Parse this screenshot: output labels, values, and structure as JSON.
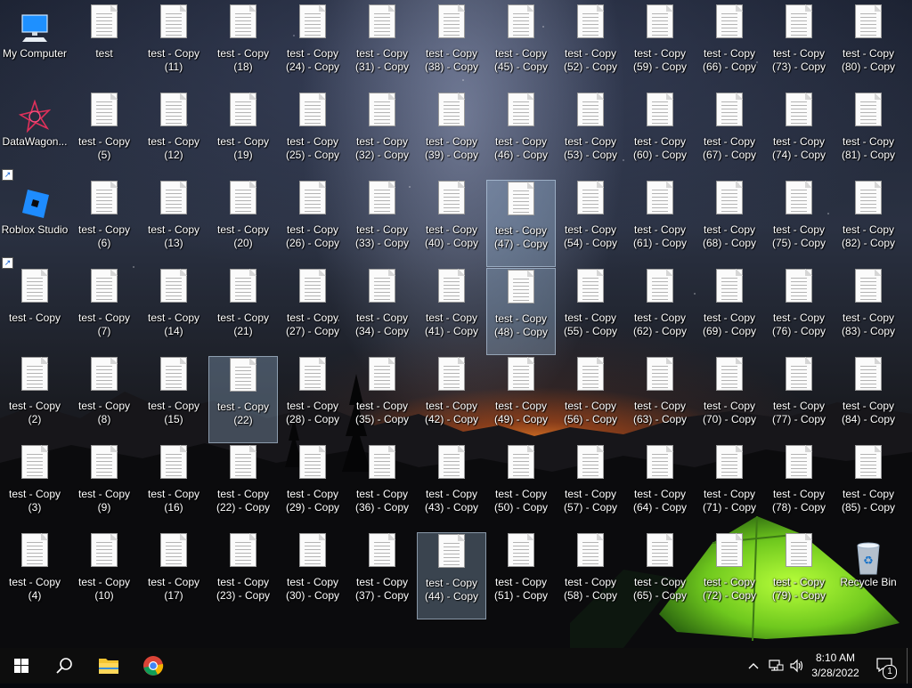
{
  "desktop": {
    "icons": [
      {
        "label": "My Computer",
        "type": "computer",
        "col": 0,
        "row": 0
      },
      {
        "label": "DataWagon...",
        "type": "datawagon",
        "col": 0,
        "row": 1
      },
      {
        "label": "Roblox Studio",
        "type": "roblox",
        "col": 0,
        "row": 2
      },
      {
        "label": "test - Copy",
        "type": "doc",
        "col": 0,
        "row": 3
      },
      {
        "label": "test - Copy\n(2)",
        "type": "doc",
        "col": 0,
        "row": 4
      },
      {
        "label": "test - Copy\n(3)",
        "type": "doc",
        "col": 0,
        "row": 5
      },
      {
        "label": "test - Copy\n(4)",
        "type": "doc",
        "col": 0,
        "row": 6
      },
      {
        "label": "test",
        "type": "doc",
        "col": 1,
        "row": 0
      },
      {
        "label": "test - Copy\n(5)",
        "type": "doc",
        "col": 1,
        "row": 1
      },
      {
        "label": "test - Copy\n(6)",
        "type": "doc",
        "col": 1,
        "row": 2
      },
      {
        "label": "test - Copy\n(7)",
        "type": "doc",
        "col": 1,
        "row": 3
      },
      {
        "label": "test - Copy\n(8)",
        "type": "doc",
        "col": 1,
        "row": 4
      },
      {
        "label": "test - Copy\n(9)",
        "type": "doc",
        "col": 1,
        "row": 5
      },
      {
        "label": "test - Copy\n(10)",
        "type": "doc",
        "col": 1,
        "row": 6
      },
      {
        "label": "test - Copy\n(11)",
        "type": "doc",
        "col": 2,
        "row": 0
      },
      {
        "label": "test - Copy\n(12)",
        "type": "doc",
        "col": 2,
        "row": 1
      },
      {
        "label": "test - Copy\n(13)",
        "type": "doc",
        "col": 2,
        "row": 2
      },
      {
        "label": "test - Copy\n(14)",
        "type": "doc",
        "col": 2,
        "row": 3
      },
      {
        "label": "test - Copy\n(15)",
        "type": "doc",
        "col": 2,
        "row": 4
      },
      {
        "label": "test - Copy\n(16)",
        "type": "doc",
        "col": 2,
        "row": 5
      },
      {
        "label": "test - Copy\n(17)",
        "type": "doc",
        "col": 2,
        "row": 6
      },
      {
        "label": "test - Copy\n(18)",
        "type": "doc",
        "col": 3,
        "row": 0
      },
      {
        "label": "test - Copy\n(19)",
        "type": "doc",
        "col": 3,
        "row": 1
      },
      {
        "label": "test - Copy\n(20)",
        "type": "doc",
        "col": 3,
        "row": 2
      },
      {
        "label": "test - Copy\n(21)",
        "type": "doc",
        "col": 3,
        "row": 3
      },
      {
        "label": "test - Copy\n(22)",
        "type": "doc",
        "col": 3,
        "row": 4,
        "selected": true
      },
      {
        "label": "test - Copy\n(22) - Copy",
        "type": "doc",
        "col": 3,
        "row": 5
      },
      {
        "label": "test - Copy\n(23) - Copy",
        "type": "doc",
        "col": 3,
        "row": 6
      },
      {
        "label": "test - Copy\n(24) - Copy",
        "type": "doc",
        "col": 4,
        "row": 0
      },
      {
        "label": "test - Copy\n(25) - Copy",
        "type": "doc",
        "col": 4,
        "row": 1
      },
      {
        "label": "test - Copy\n(26) - Copy",
        "type": "doc",
        "col": 4,
        "row": 2
      },
      {
        "label": "test - Copy\n(27) - Copy",
        "type": "doc",
        "col": 4,
        "row": 3
      },
      {
        "label": "test - Copy\n(28) - Copy",
        "type": "doc",
        "col": 4,
        "row": 4
      },
      {
        "label": "test - Copy\n(29) - Copy",
        "type": "doc",
        "col": 4,
        "row": 5
      },
      {
        "label": "test - Copy\n(30) - Copy",
        "type": "doc",
        "col": 4,
        "row": 6
      },
      {
        "label": "test - Copy\n(31) - Copy",
        "type": "doc",
        "col": 5,
        "row": 0
      },
      {
        "label": "test - Copy\n(32) - Copy",
        "type": "doc",
        "col": 5,
        "row": 1
      },
      {
        "label": "test - Copy\n(33) - Copy",
        "type": "doc",
        "col": 5,
        "row": 2
      },
      {
        "label": "test - Copy\n(34) - Copy",
        "type": "doc",
        "col": 5,
        "row": 3
      },
      {
        "label": "test - Copy\n(35) - Copy",
        "type": "doc",
        "col": 5,
        "row": 4
      },
      {
        "label": "test - Copy\n(36) - Copy",
        "type": "doc",
        "col": 5,
        "row": 5
      },
      {
        "label": "test - Copy\n(37) - Copy",
        "type": "doc",
        "col": 5,
        "row": 6
      },
      {
        "label": "test - Copy\n(38) - Copy",
        "type": "doc",
        "col": 6,
        "row": 0
      },
      {
        "label": "test - Copy\n(39) - Copy",
        "type": "doc",
        "col": 6,
        "row": 1
      },
      {
        "label": "test - Copy\n(40) - Copy",
        "type": "doc",
        "col": 6,
        "row": 2
      },
      {
        "label": "test - Copy\n(41) - Copy",
        "type": "doc",
        "col": 6,
        "row": 3
      },
      {
        "label": "test - Copy\n(42) - Copy",
        "type": "doc",
        "col": 6,
        "row": 4
      },
      {
        "label": "test - Copy\n(43) - Copy",
        "type": "doc",
        "col": 6,
        "row": 5
      },
      {
        "label": "test - Copy\n(44) - Copy",
        "type": "doc",
        "col": 6,
        "row": 6,
        "selected": true
      },
      {
        "label": "test - Copy\n(45) - Copy",
        "type": "doc",
        "col": 7,
        "row": 0
      },
      {
        "label": "test - Copy\n(46) - Copy",
        "type": "doc",
        "col": 7,
        "row": 1
      },
      {
        "label": "test - Copy\n(47) - Copy",
        "type": "doc",
        "col": 7,
        "row": 2,
        "selected": true
      },
      {
        "label": "test - Copy\n(48) - Copy",
        "type": "doc",
        "col": 7,
        "row": 3,
        "selected": true
      },
      {
        "label": "test - Copy\n(49) - Copy",
        "type": "doc",
        "col": 7,
        "row": 4
      },
      {
        "label": "test - Copy\n(50) - Copy",
        "type": "doc",
        "col": 7,
        "row": 5
      },
      {
        "label": "test - Copy\n(51) - Copy",
        "type": "doc",
        "col": 7,
        "row": 6
      },
      {
        "label": "test - Copy\n(52) - Copy",
        "type": "doc",
        "col": 8,
        "row": 0
      },
      {
        "label": "test - Copy\n(53) - Copy",
        "type": "doc",
        "col": 8,
        "row": 1
      },
      {
        "label": "test - Copy\n(54) - Copy",
        "type": "doc",
        "col": 8,
        "row": 2
      },
      {
        "label": "test - Copy\n(55) - Copy",
        "type": "doc",
        "col": 8,
        "row": 3
      },
      {
        "label": "test - Copy\n(56) - Copy",
        "type": "doc",
        "col": 8,
        "row": 4
      },
      {
        "label": "test - Copy\n(57) - Copy",
        "type": "doc",
        "col": 8,
        "row": 5
      },
      {
        "label": "test - Copy\n(58) - Copy",
        "type": "doc",
        "col": 8,
        "row": 6
      },
      {
        "label": "test - Copy\n(59) - Copy",
        "type": "doc",
        "col": 9,
        "row": 0
      },
      {
        "label": "test - Copy\n(60) - Copy",
        "type": "doc",
        "col": 9,
        "row": 1
      },
      {
        "label": "test - Copy\n(61) - Copy",
        "type": "doc",
        "col": 9,
        "row": 2
      },
      {
        "label": "test - Copy\n(62) - Copy",
        "type": "doc",
        "col": 9,
        "row": 3
      },
      {
        "label": "test - Copy\n(63) - Copy",
        "type": "doc",
        "col": 9,
        "row": 4
      },
      {
        "label": "test - Copy\n(64) - Copy",
        "type": "doc",
        "col": 9,
        "row": 5
      },
      {
        "label": "test - Copy\n(65) - Copy",
        "type": "doc",
        "col": 9,
        "row": 6
      },
      {
        "label": "test - Copy\n(66) - Copy",
        "type": "doc",
        "col": 10,
        "row": 0
      },
      {
        "label": "test - Copy\n(67) - Copy",
        "type": "doc",
        "col": 10,
        "row": 1
      },
      {
        "label": "test - Copy\n(68) - Copy",
        "type": "doc",
        "col": 10,
        "row": 2
      },
      {
        "label": "test - Copy\n(69) - Copy",
        "type": "doc",
        "col": 10,
        "row": 3
      },
      {
        "label": "test - Copy\n(70) - Copy",
        "type": "doc",
        "col": 10,
        "row": 4
      },
      {
        "label": "test - Copy\n(71) - Copy",
        "type": "doc",
        "col": 10,
        "row": 5
      },
      {
        "label": "test - Copy\n(72) - Copy",
        "type": "doc",
        "col": 10,
        "row": 6
      },
      {
        "label": "test - Copy\n(73) - Copy",
        "type": "doc",
        "col": 11,
        "row": 0
      },
      {
        "label": "test - Copy\n(74) - Copy",
        "type": "doc",
        "col": 11,
        "row": 1
      },
      {
        "label": "test - Copy\n(75) - Copy",
        "type": "doc",
        "col": 11,
        "row": 2
      },
      {
        "label": "test - Copy\n(76) - Copy",
        "type": "doc",
        "col": 11,
        "row": 3
      },
      {
        "label": "test - Copy\n(77) - Copy",
        "type": "doc",
        "col": 11,
        "row": 4
      },
      {
        "label": "test - Copy\n(78) - Copy",
        "type": "doc",
        "col": 11,
        "row": 5
      },
      {
        "label": "test - Copy\n(79) - Copy",
        "type": "doc",
        "col": 11,
        "row": 6
      },
      {
        "label": "test - Copy\n(80) - Copy",
        "type": "doc",
        "col": 12,
        "row": 0
      },
      {
        "label": "test - Copy\n(81) - Copy",
        "type": "doc",
        "col": 12,
        "row": 1
      },
      {
        "label": "test - Copy\n(82) - Copy",
        "type": "doc",
        "col": 12,
        "row": 2
      },
      {
        "label": "test - Copy\n(83) - Copy",
        "type": "doc",
        "col": 12,
        "row": 3
      },
      {
        "label": "test - Copy\n(84) - Copy",
        "type": "doc",
        "col": 12,
        "row": 4
      },
      {
        "label": "test - Copy\n(85) - Copy",
        "type": "doc",
        "col": 12,
        "row": 5
      },
      {
        "label": "Recycle Bin",
        "type": "recycle",
        "col": 12,
        "row": 6
      }
    ]
  },
  "taskbar": {
    "items": [
      {
        "name": "windows-start-icon"
      },
      {
        "name": "search-icon"
      },
      {
        "name": "file-explorer-icon"
      },
      {
        "name": "chrome-icon"
      }
    ],
    "tray": {
      "icons": [
        "chevron-up-icon",
        "network-icon",
        "volume-icon"
      ],
      "time": "8:10 AM",
      "date": "3/28/2022",
      "notification_count": "1"
    }
  },
  "colors": {
    "taskbar_bg": "#0d0d0d",
    "selection": "#a0bedc",
    "explorer_yellow": "#f4c430",
    "roblox_blue": "#1e8cff"
  }
}
